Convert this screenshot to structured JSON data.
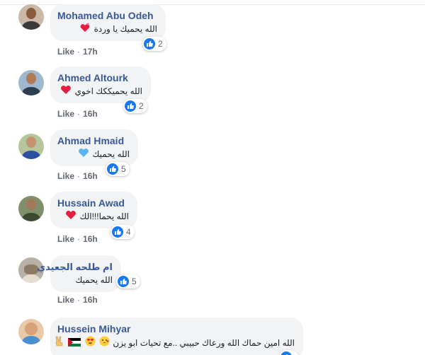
{
  "comments": [
    {
      "author": "Mohamed Abu Odeh",
      "text": "الله يحميك يا وردة",
      "emojis": [
        "revolving-hearts-emoji"
      ],
      "reaction_count": "2",
      "like_label": "Like",
      "time": "17h"
    },
    {
      "author": "Ahmed Altourk",
      "text": "الله يحميككك اخوي",
      "emojis": [
        "red-heart-emoji"
      ],
      "reaction_count": "2",
      "like_label": "Like",
      "time": "16h"
    },
    {
      "author": "Ahmad Hmaid",
      "text": "الله يحميك",
      "emojis": [
        "blue-heart-emoji"
      ],
      "reaction_count": "5",
      "like_label": "Like",
      "time": "16h"
    },
    {
      "author": "Hussain Awad",
      "text": "الله يحما!!!الك",
      "emojis": [
        "red-heart-emoji"
      ],
      "reaction_count": "4",
      "like_label": "Like",
      "time": "16h"
    },
    {
      "author": "ام طلحه الجعيدي",
      "text": "الله يحميك",
      "emojis": [],
      "reaction_count": "5",
      "like_label": "Like",
      "time": "16h"
    },
    {
      "author": "Hussein Mihyar",
      "text": "الله امين حماك الله ورعاك حبيبي ..مع تحيات ابو يزن",
      "emojis": [
        "kissing-heart-emoji",
        "heart-eyes-emoji",
        "palestine-flag-emoji",
        "victory-hand-emoji"
      ],
      "reaction_count": "",
      "like_label": "",
      "time": ""
    }
  ],
  "colors": {
    "name_link": "#385898",
    "bubble_bg": "#f2f3f5",
    "like_blue": "#1877f2",
    "heart_red": "#e41e3f",
    "heart_blue": "#5bb3f0"
  }
}
